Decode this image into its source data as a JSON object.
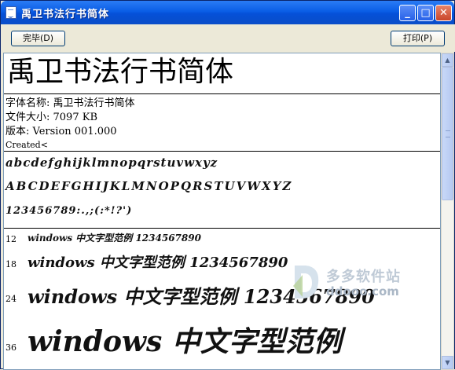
{
  "window": {
    "title": "禹卫书法行书简体",
    "controls": {
      "minimize": "_",
      "maximize": "□",
      "close": "✕"
    }
  },
  "toolbar": {
    "done_label": "完毕(D)",
    "print_label": "打印(P)"
  },
  "preview": {
    "font_name_large": "禹卫书法行书简体",
    "info": {
      "name_line": "字体名称: 禹卫书法行书简体",
      "size_line": "文件大小: 7097 KB",
      "version_line": "版本: Version 001.000",
      "created_line": "Created<"
    },
    "samples": {
      "lowercase": "abcdefghijklmnopqrstuvwxyz",
      "uppercase": "ABCDEFGHIJKLMNOPQRSTUVWXYZ",
      "digits": "123456789:.,;(:*!?')"
    },
    "size_samples": [
      {
        "size": "12",
        "text": "windows 中文字型范例 1234567890"
      },
      {
        "size": "18",
        "text": "windows 中文字型范例 1234567890"
      },
      {
        "size": "24",
        "text": "windows 中文字型范例 1234567890"
      },
      {
        "size": "36",
        "text": "windows 中文字型范例"
      }
    ]
  },
  "watermark": {
    "name": "多多软件站",
    "url": "ddooo.com"
  },
  "colors": {
    "titlebar": "#0a5ee6",
    "frame": "#ece9d8",
    "close_button": "#c9452a"
  }
}
